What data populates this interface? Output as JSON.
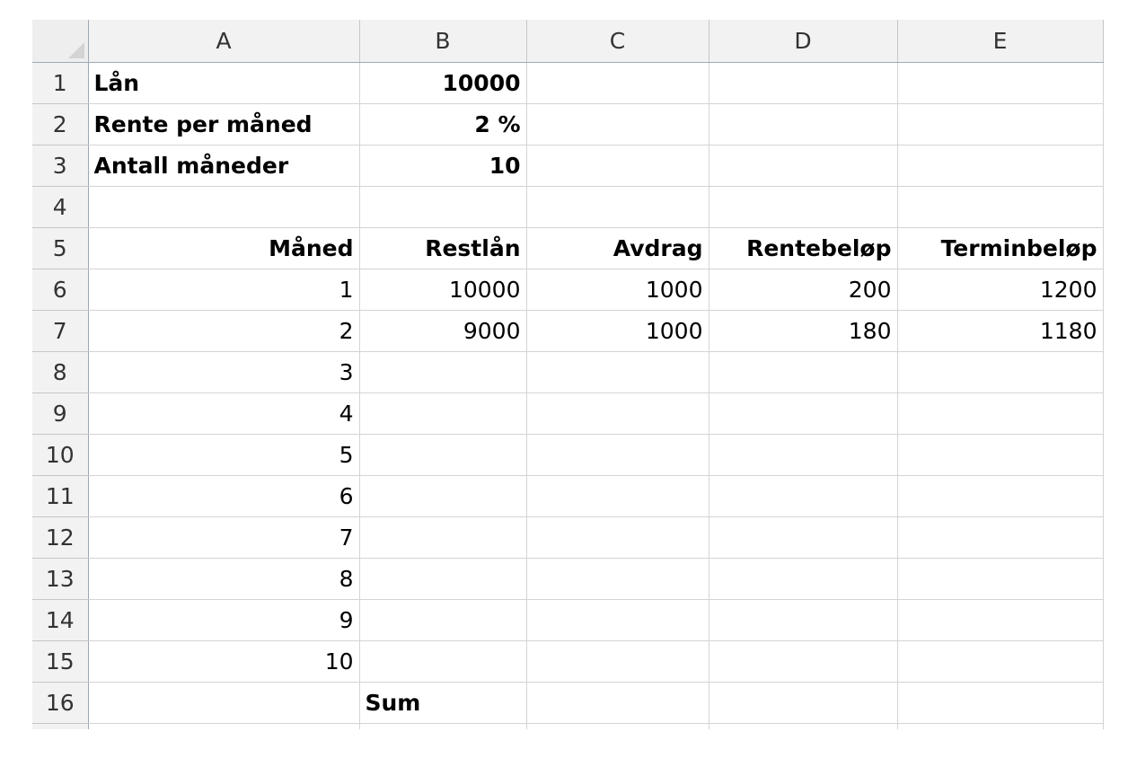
{
  "sheet": {
    "columns": [
      "A",
      "B",
      "C",
      "D",
      "E"
    ],
    "rows": [
      {
        "num": "1",
        "cells": [
          "Lån",
          "10000",
          "",
          "",
          ""
        ],
        "bold": [
          true,
          true,
          false,
          false,
          false
        ],
        "align": [
          "left",
          "right",
          "right",
          "right",
          "right"
        ]
      },
      {
        "num": "2",
        "cells": [
          "Rente per måned",
          "2 %",
          "",
          "",
          ""
        ],
        "bold": [
          true,
          true,
          false,
          false,
          false
        ],
        "align": [
          "left",
          "right",
          "right",
          "right",
          "right"
        ]
      },
      {
        "num": "3",
        "cells": [
          "Antall måneder",
          "10",
          "",
          "",
          ""
        ],
        "bold": [
          true,
          true,
          false,
          false,
          false
        ],
        "align": [
          "left",
          "right",
          "right",
          "right",
          "right"
        ]
      },
      {
        "num": "4",
        "cells": [
          "",
          "",
          "",
          "",
          ""
        ],
        "bold": [
          false,
          false,
          false,
          false,
          false
        ],
        "align": [
          "left",
          "right",
          "right",
          "right",
          "right"
        ]
      },
      {
        "num": "5",
        "cells": [
          "Måned",
          "Restlån",
          "Avdrag",
          "Rentebeløp",
          "Terminbeløp"
        ],
        "bold": [
          true,
          true,
          true,
          true,
          true
        ],
        "align": [
          "right",
          "right",
          "right",
          "right",
          "right"
        ]
      },
      {
        "num": "6",
        "cells": [
          "1",
          "10000",
          "1000",
          "200",
          "1200"
        ],
        "bold": [
          false,
          false,
          false,
          false,
          false
        ],
        "align": [
          "right",
          "right",
          "right",
          "right",
          "right"
        ]
      },
      {
        "num": "7",
        "cells": [
          "2",
          "9000",
          "1000",
          "180",
          "1180"
        ],
        "bold": [
          false,
          false,
          false,
          false,
          false
        ],
        "align": [
          "right",
          "right",
          "right",
          "right",
          "right"
        ]
      },
      {
        "num": "8",
        "cells": [
          "3",
          "",
          "",
          "",
          ""
        ],
        "bold": [
          false,
          false,
          false,
          false,
          false
        ],
        "align": [
          "right",
          "right",
          "right",
          "right",
          "right"
        ]
      },
      {
        "num": "9",
        "cells": [
          "4",
          "",
          "",
          "",
          ""
        ],
        "bold": [
          false,
          false,
          false,
          false,
          false
        ],
        "align": [
          "right",
          "right",
          "right",
          "right",
          "right"
        ]
      },
      {
        "num": "10",
        "cells": [
          "5",
          "",
          "",
          "",
          ""
        ],
        "bold": [
          false,
          false,
          false,
          false,
          false
        ],
        "align": [
          "right",
          "right",
          "right",
          "right",
          "right"
        ]
      },
      {
        "num": "11",
        "cells": [
          "6",
          "",
          "",
          "",
          ""
        ],
        "bold": [
          false,
          false,
          false,
          false,
          false
        ],
        "align": [
          "right",
          "right",
          "right",
          "right",
          "right"
        ]
      },
      {
        "num": "12",
        "cells": [
          "7",
          "",
          "",
          "",
          ""
        ],
        "bold": [
          false,
          false,
          false,
          false,
          false
        ],
        "align": [
          "right",
          "right",
          "right",
          "right",
          "right"
        ]
      },
      {
        "num": "13",
        "cells": [
          "8",
          "",
          "",
          "",
          ""
        ],
        "bold": [
          false,
          false,
          false,
          false,
          false
        ],
        "align": [
          "right",
          "right",
          "right",
          "right",
          "right"
        ]
      },
      {
        "num": "14",
        "cells": [
          "9",
          "",
          "",
          "",
          ""
        ],
        "bold": [
          false,
          false,
          false,
          false,
          false
        ],
        "align": [
          "right",
          "right",
          "right",
          "right",
          "right"
        ]
      },
      {
        "num": "15",
        "cells": [
          "10",
          "",
          "",
          "",
          ""
        ],
        "bold": [
          false,
          false,
          false,
          false,
          false
        ],
        "align": [
          "right",
          "right",
          "right",
          "right",
          "right"
        ]
      },
      {
        "num": "16",
        "cells": [
          "",
          "Sum",
          "",
          "",
          ""
        ],
        "bold": [
          false,
          true,
          false,
          false,
          false
        ],
        "align": [
          "right",
          "left",
          "right",
          "right",
          "right"
        ]
      }
    ]
  },
  "colors": {
    "header_bg": "#f2f2f2",
    "gridline": "#d4d4d4",
    "header_border": "#9fa8b4"
  }
}
